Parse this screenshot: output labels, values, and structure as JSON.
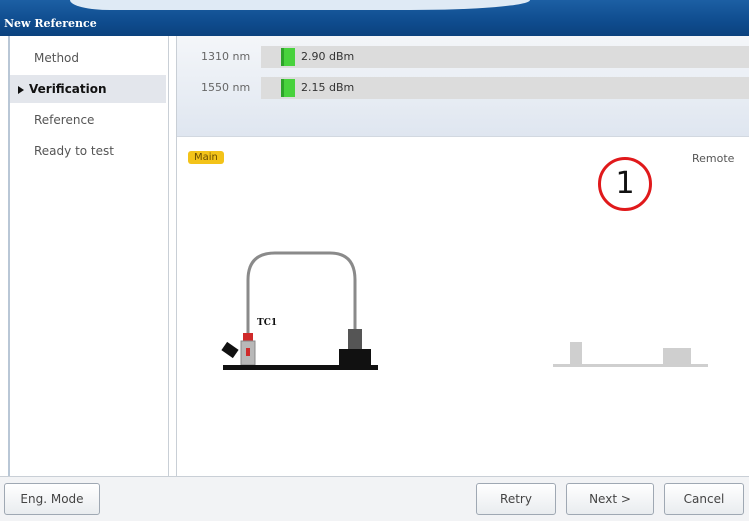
{
  "window": {
    "title": "New Reference"
  },
  "sidebar": {
    "items": [
      {
        "label": "Method",
        "active": false
      },
      {
        "label": "Verification",
        "active": true
      },
      {
        "label": "Reference",
        "active": false
      },
      {
        "label": "Ready to test",
        "active": false
      }
    ]
  },
  "power": {
    "rows": [
      {
        "wavelength": "1310 nm",
        "value": "2.90 dBm"
      },
      {
        "wavelength": "1550 nm",
        "value": "2.15 dBm"
      }
    ],
    "fill_color": "#48d23d"
  },
  "diagram": {
    "main_label": "Main",
    "remote_label": "Remote",
    "cable_label": "TC1",
    "marker": "1",
    "colors": {
      "main_badge": "#f3c319",
      "marker_ring": "#e0191b"
    }
  },
  "footer": {
    "eng_mode": "Eng. Mode",
    "retry": "Retry",
    "next": "Next >",
    "cancel": "Cancel"
  }
}
